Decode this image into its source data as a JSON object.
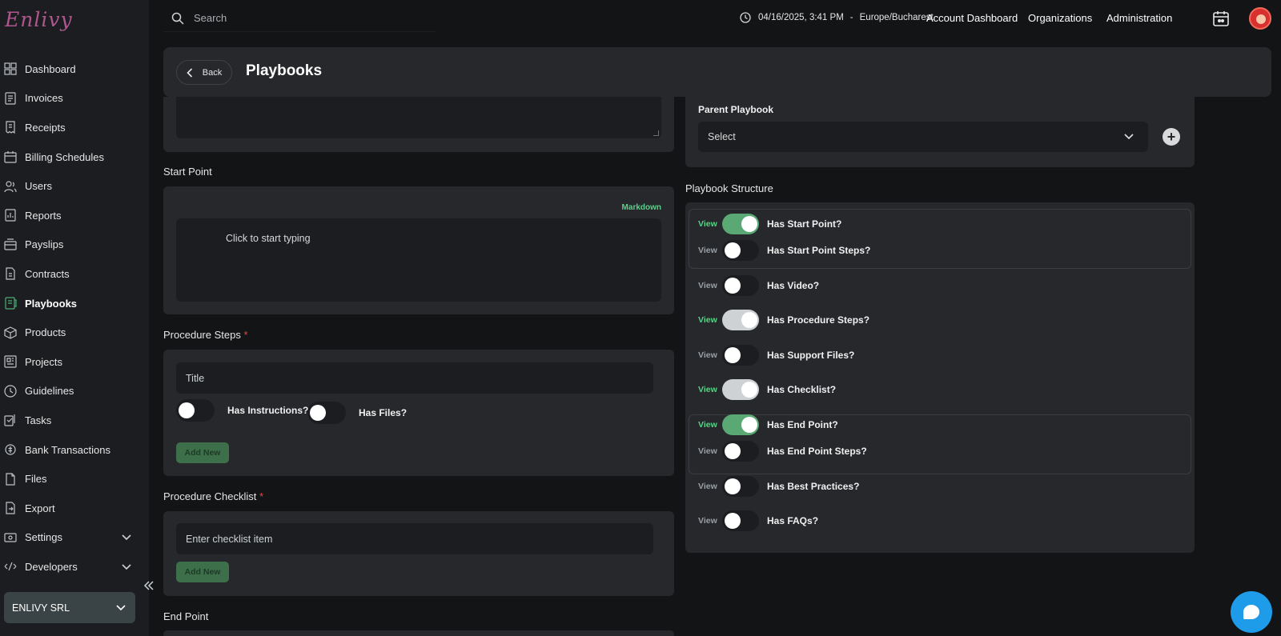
{
  "brand": {
    "logo_text": "Enlivy"
  },
  "sidebar": {
    "items": [
      {
        "label": "Dashboard",
        "icon": "dashboard-icon"
      },
      {
        "label": "Invoices",
        "icon": "invoice-icon"
      },
      {
        "label": "Receipts",
        "icon": "receipt-icon"
      },
      {
        "label": "Billing Schedules",
        "icon": "billing-schedule-icon"
      },
      {
        "label": "Users",
        "icon": "users-icon"
      },
      {
        "label": "Reports",
        "icon": "reports-icon"
      },
      {
        "label": "Payslips",
        "icon": "payslip-icon"
      },
      {
        "label": "Contracts",
        "icon": "contract-icon"
      },
      {
        "label": "Playbooks",
        "icon": "playbook-icon",
        "active": true
      },
      {
        "label": "Products",
        "icon": "product-box-icon"
      },
      {
        "label": "Projects",
        "icon": "project-icon"
      },
      {
        "label": "Guidelines",
        "icon": "guidelines-icon"
      },
      {
        "label": "Tasks",
        "icon": "tasks-icon"
      },
      {
        "label": "Bank Transactions",
        "icon": "bank-icon"
      },
      {
        "label": "Files",
        "icon": "file-icon"
      },
      {
        "label": "Export",
        "icon": "export-icon"
      },
      {
        "label": "Settings",
        "icon": "settings-icon",
        "expandable": true
      },
      {
        "label": "Developers",
        "icon": "developers-icon",
        "expandable": true
      }
    ],
    "org_name": "ENLIVY SRL"
  },
  "topbar": {
    "search_placeholder": "Search",
    "datetime": "04/16/2025, 3:41 PM",
    "timezone": "Europe/Bucharest",
    "separator": "-",
    "links": [
      "Account Dashboard",
      "Organizations",
      "Administration"
    ]
  },
  "header": {
    "back_label": "Back",
    "title": "Playbooks"
  },
  "left": {
    "start_point": {
      "label": "Start Point",
      "markdown_label": "Markdown",
      "editor_placeholder": "Click to start typing"
    },
    "procedure_steps": {
      "label": "Procedure Steps",
      "required_mark": "*",
      "title_placeholder": "Title",
      "has_instructions_label": "Has Instructions?",
      "has_instructions": false,
      "has_files_label": "Has Files?",
      "has_files": false,
      "add_new_label": "Add New"
    },
    "procedure_checklist": {
      "label": "Procedure Checklist",
      "required_mark": "*",
      "item_placeholder": "Enter checklist item",
      "add_new_label": "Add New"
    },
    "end_point": {
      "label": "End Point"
    }
  },
  "right": {
    "parent_playbook": {
      "label": "Parent Playbook",
      "value": "Select"
    },
    "structure": {
      "label": "Playbook Structure",
      "view_label": "View",
      "rows": [
        {
          "label": "Has Start Point?",
          "state": "on"
        },
        {
          "label": "Has Start Point Steps?",
          "state": "off"
        },
        {
          "label": "Has Video?",
          "state": "off"
        },
        {
          "label": "Has Procedure Steps?",
          "state": "on-grey"
        },
        {
          "label": "Has Support Files?",
          "state": "off"
        },
        {
          "label": "Has Checklist?",
          "state": "on-grey"
        },
        {
          "label": "Has End Point?",
          "state": "on"
        },
        {
          "label": "Has End Point Steps?",
          "state": "off"
        },
        {
          "label": "Has Best Practices?",
          "state": "off"
        },
        {
          "label": "Has FAQs?",
          "state": "off"
        }
      ]
    }
  },
  "colors": {
    "accent_green": "#5aa975",
    "markdown_green": "#5bd28a",
    "chat_blue": "#1e9be9",
    "required_red": "#e04a4a"
  }
}
